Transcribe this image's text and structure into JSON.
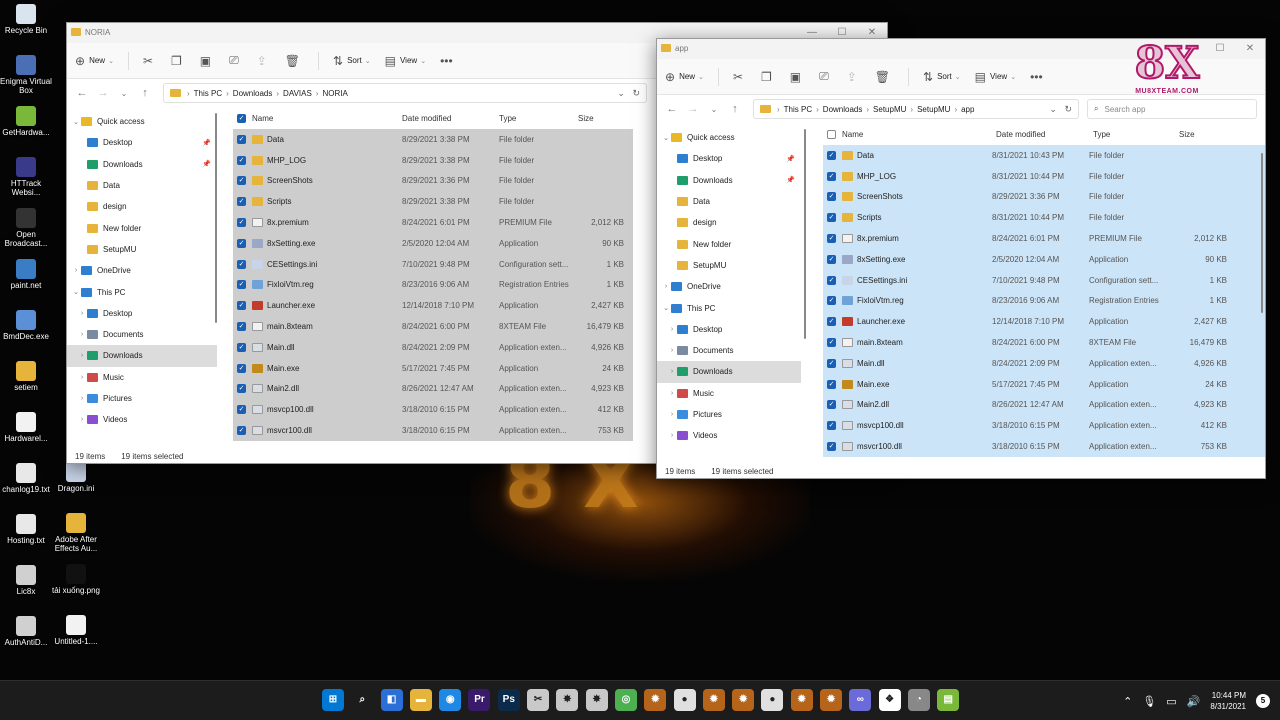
{
  "desktop": {
    "icons": [
      {
        "label": "Recycle Bin",
        "icon": "recycle-bin-icon"
      },
      {
        "label": "Enigma Virtual Box",
        "icon": "enigma-icon"
      },
      {
        "label": "GetHardwa...",
        "icon": "app-icon"
      },
      {
        "label": "HTTrack Websi...",
        "icon": "httrack-icon"
      },
      {
        "label": "Open Broadcast...",
        "icon": "obs-icon"
      },
      {
        "label": "paint.net",
        "icon": "paint-icon"
      },
      {
        "label": "BmdDec.exe",
        "icon": "gear-icon"
      },
      {
        "label": "setiem",
        "icon": "folder-icon"
      },
      {
        "label": "Hardwarel...",
        "icon": "file-icon"
      },
      {
        "label": "chanlog19.txt",
        "icon": "text-file-icon"
      },
      {
        "label": "Hosting.txt",
        "icon": "text-file-icon"
      },
      {
        "label": "Lic8x",
        "icon": "8x-icon"
      },
      {
        "label": "AuthAntiD...",
        "icon": "8x-icon"
      }
    ],
    "icons2": [
      {
        "label": "Dragon.ini",
        "icon": "settings-file-icon"
      },
      {
        "label": "Adobe After Effects Au...",
        "icon": "folder-icon"
      },
      {
        "label": "tải xuống.png",
        "icon": "image-file-icon"
      },
      {
        "label": "Untitled-1....",
        "icon": "file-icon"
      }
    ]
  },
  "window_left": {
    "title": "NORIA",
    "toolbar": {
      "new": "New",
      "sort": "Sort",
      "view": "View"
    },
    "breadcrumb": [
      "This PC",
      "Downloads",
      "DAVIAS",
      "NORIA"
    ],
    "sidebar": [
      {
        "label": "Quick access",
        "icon": "star-icon",
        "level": 0,
        "expand": "⌄"
      },
      {
        "label": "Desktop",
        "icon": "desktop-icon",
        "level": 1,
        "pin": true
      },
      {
        "label": "Downloads",
        "icon": "download-icon",
        "level": 1,
        "pin": true
      },
      {
        "label": "Data",
        "icon": "folder-icon",
        "level": 1
      },
      {
        "label": "design",
        "icon": "folder-icon",
        "level": 1
      },
      {
        "label": "New folder",
        "icon": "folder-icon",
        "level": 1
      },
      {
        "label": "SetupMU",
        "icon": "folder-icon",
        "level": 1
      },
      {
        "label": "OneDrive",
        "icon": "cloud-icon",
        "level": 0,
        "expand": "›"
      },
      {
        "label": "This PC",
        "icon": "pc-icon",
        "level": 0,
        "expand": "⌄"
      },
      {
        "label": "Desktop",
        "icon": "desktop-icon",
        "level": 1,
        "expand": "›"
      },
      {
        "label": "Documents",
        "icon": "document-icon",
        "level": 1,
        "expand": "›"
      },
      {
        "label": "Downloads",
        "icon": "download-icon",
        "level": 1,
        "expand": "›",
        "selected": true
      },
      {
        "label": "Music",
        "icon": "music-icon",
        "level": 1,
        "expand": "›"
      },
      {
        "label": "Pictures",
        "icon": "picture-icon",
        "level": 1,
        "expand": "›"
      },
      {
        "label": "Videos",
        "icon": "video-icon",
        "level": 1,
        "expand": "›"
      }
    ],
    "columns": [
      "Name",
      "Date modified",
      "Type",
      "Size"
    ],
    "status": {
      "count": "19 items",
      "selected": "19 items selected"
    }
  },
  "window_right": {
    "title": "app",
    "toolbar": {
      "new": "New",
      "sort": "Sort",
      "view": "View"
    },
    "breadcrumb": [
      "This PC",
      "Downloads",
      "SetupMU",
      "SetupMU",
      "app"
    ],
    "search_placeholder": "Search app",
    "sidebar": [
      {
        "label": "Quick access",
        "icon": "star-icon",
        "level": 0,
        "expand": "⌄"
      },
      {
        "label": "Desktop",
        "icon": "desktop-icon",
        "level": 1,
        "pin": true
      },
      {
        "label": "Downloads",
        "icon": "download-icon",
        "level": 1,
        "pin": true
      },
      {
        "label": "Data",
        "icon": "folder-icon",
        "level": 1
      },
      {
        "label": "design",
        "icon": "folder-icon",
        "level": 1
      },
      {
        "label": "New folder",
        "icon": "folder-icon",
        "level": 1
      },
      {
        "label": "SetupMU",
        "icon": "folder-icon",
        "level": 1
      },
      {
        "label": "OneDrive",
        "icon": "cloud-icon",
        "level": 0,
        "expand": "›"
      },
      {
        "label": "This PC",
        "icon": "pc-icon",
        "level": 0,
        "expand": "⌄"
      },
      {
        "label": "Desktop",
        "icon": "desktop-icon",
        "level": 1,
        "expand": "›"
      },
      {
        "label": "Documents",
        "icon": "document-icon",
        "level": 1,
        "expand": "›"
      },
      {
        "label": "Downloads",
        "icon": "download-icon",
        "level": 1,
        "expand": "›",
        "selected": true
      },
      {
        "label": "Music",
        "icon": "music-icon",
        "level": 1,
        "expand": "›"
      },
      {
        "label": "Pictures",
        "icon": "picture-icon",
        "level": 1,
        "expand": "›"
      },
      {
        "label": "Videos",
        "icon": "video-icon",
        "level": 1,
        "expand": "›"
      }
    ],
    "columns": [
      "Name",
      "Date modified",
      "Type",
      "Size"
    ],
    "status": {
      "count": "19 items",
      "selected": "19 items selected"
    }
  },
  "files_left": [
    {
      "name": "Data",
      "date": "8/29/2021 3:38 PM",
      "type": "File folder",
      "size": "",
      "icon": "folder-icon"
    },
    {
      "name": "MHP_LOG",
      "date": "8/29/2021 3:38 PM",
      "type": "File folder",
      "size": "",
      "icon": "folder-icon"
    },
    {
      "name": "ScreenShots",
      "date": "8/29/2021 3:36 PM",
      "type": "File folder",
      "size": "",
      "icon": "folder-icon"
    },
    {
      "name": "Scripts",
      "date": "8/29/2021 3:38 PM",
      "type": "File folder",
      "size": "",
      "icon": "folder-icon"
    },
    {
      "name": "8x.premium",
      "date": "8/24/2021 6:01 PM",
      "type": "PREMIUM File",
      "size": "2,012 KB",
      "icon": "file-icon"
    },
    {
      "name": "8xSetting.exe",
      "date": "2/5/2020 12:04 AM",
      "type": "Application",
      "size": "90 KB",
      "icon": "settings-app-icon"
    },
    {
      "name": "CESettings.ini",
      "date": "7/10/2021 9:48 PM",
      "type": "Configuration sett...",
      "size": "1 KB",
      "icon": "settings-file-icon"
    },
    {
      "name": "FixloiVtm.reg",
      "date": "8/23/2016 9:06 AM",
      "type": "Registration Entries",
      "size": "1 KB",
      "icon": "registry-icon"
    },
    {
      "name": "Launcher.exe",
      "date": "12/14/2018 7:10 PM",
      "type": "Application",
      "size": "2,427 KB",
      "icon": "launcher-icon"
    },
    {
      "name": "main.8xteam",
      "date": "8/24/2021 6:00 PM",
      "type": "8XTEAM File",
      "size": "16,479 KB",
      "icon": "file-icon"
    },
    {
      "name": "Main.dll",
      "date": "8/24/2021 2:09 PM",
      "type": "Application exten...",
      "size": "4,926 KB",
      "icon": "dll-icon"
    },
    {
      "name": "Main.exe",
      "date": "5/17/2021 7:45 PM",
      "type": "Application",
      "size": "24 KB",
      "icon": "game-icon"
    },
    {
      "name": "Main2.dll",
      "date": "8/26/2021 12:47 AM",
      "type": "Application exten...",
      "size": "4,923 KB",
      "icon": "dll-icon"
    },
    {
      "name": "msvcp100.dll",
      "date": "3/18/2010 6:15 PM",
      "type": "Application exten...",
      "size": "412 KB",
      "icon": "dll-icon"
    },
    {
      "name": "msvcr100.dll",
      "date": "3/18/2010 6:15 PM",
      "type": "Application exten...",
      "size": "753 KB",
      "icon": "dll-icon"
    }
  ],
  "files_right": [
    {
      "name": "Data",
      "date": "8/31/2021 10:43 PM",
      "type": "File folder",
      "size": "",
      "icon": "folder-icon"
    },
    {
      "name": "MHP_LOG",
      "date": "8/31/2021 10:44 PM",
      "type": "File folder",
      "size": "",
      "icon": "folder-icon"
    },
    {
      "name": "ScreenShots",
      "date": "8/29/2021 3:36 PM",
      "type": "File folder",
      "size": "",
      "icon": "folder-icon"
    },
    {
      "name": "Scripts",
      "date": "8/31/2021 10:44 PM",
      "type": "File folder",
      "size": "",
      "icon": "folder-icon"
    },
    {
      "name": "8x.premium",
      "date": "8/24/2021 6:01 PM",
      "type": "PREMIUM File",
      "size": "2,012 KB",
      "icon": "file-icon"
    },
    {
      "name": "8xSetting.exe",
      "date": "2/5/2020 12:04 AM",
      "type": "Application",
      "size": "90 KB",
      "icon": "settings-app-icon"
    },
    {
      "name": "CESettings.ini",
      "date": "7/10/2021 9:48 PM",
      "type": "Configuration sett...",
      "size": "1 KB",
      "icon": "settings-file-icon"
    },
    {
      "name": "FixloiVtm.reg",
      "date": "8/23/2016 9:06 AM",
      "type": "Registration Entries",
      "size": "1 KB",
      "icon": "registry-icon"
    },
    {
      "name": "Launcher.exe",
      "date": "12/14/2018 7:10 PM",
      "type": "Application",
      "size": "2,427 KB",
      "icon": "launcher-icon"
    },
    {
      "name": "main.8xteam",
      "date": "8/24/2021 6:00 PM",
      "type": "8XTEAM File",
      "size": "16,479 KB",
      "icon": "file-icon"
    },
    {
      "name": "Main.dll",
      "date": "8/24/2021 2:09 PM",
      "type": "Application exten...",
      "size": "4,926 KB",
      "icon": "dll-icon"
    },
    {
      "name": "Main.exe",
      "date": "5/17/2021 7:45 PM",
      "type": "Application",
      "size": "24 KB",
      "icon": "game-icon"
    },
    {
      "name": "Main2.dll",
      "date": "8/26/2021 12:47 AM",
      "type": "Application exten...",
      "size": "4,923 KB",
      "icon": "dll-icon"
    },
    {
      "name": "msvcp100.dll",
      "date": "3/18/2010 6:15 PM",
      "type": "Application exten...",
      "size": "412 KB",
      "icon": "dll-icon"
    },
    {
      "name": "msvcr100.dll",
      "date": "3/18/2010 6:15 PM",
      "type": "Application exten...",
      "size": "753 KB",
      "icon": "dll-icon"
    }
  ],
  "logo": {
    "big": "8X",
    "small": "MU8XTEAM.COM"
  },
  "taskbar": {
    "apps": [
      "windows-start-icon",
      "search-icon",
      "store-icon",
      "file-explorer-icon",
      "browser-icon",
      "premiere-icon",
      "photoshop-icon",
      "tools-icon",
      "8x-icon",
      "8x-icon",
      "app-icon",
      "game-icon",
      "media-icon",
      "game-icon",
      "game-icon",
      "media-icon",
      "game-icon",
      "game-icon",
      "link-icon",
      "app-icon",
      "clock-icon",
      "notepad-icon"
    ],
    "app_glyphs": [
      "⊞",
      "⌕",
      "◧",
      "▬",
      "◉",
      "Pr",
      "Ps",
      "✂",
      "✸",
      "✸",
      "◎",
      "✹",
      "●",
      "✹",
      "✹",
      "●",
      "✹",
      "✹",
      "∞",
      "❖",
      "◔",
      "▤"
    ],
    "time": "10:44 PM",
    "date": "8/31/2021",
    "notifications": "5"
  },
  "colors": {
    "accent": "#1a5fb4",
    "folder": "#e7b43b",
    "selection_right": "#cce4f7",
    "selection_left": "#cdcdcd",
    "logo": "#b0196a"
  }
}
